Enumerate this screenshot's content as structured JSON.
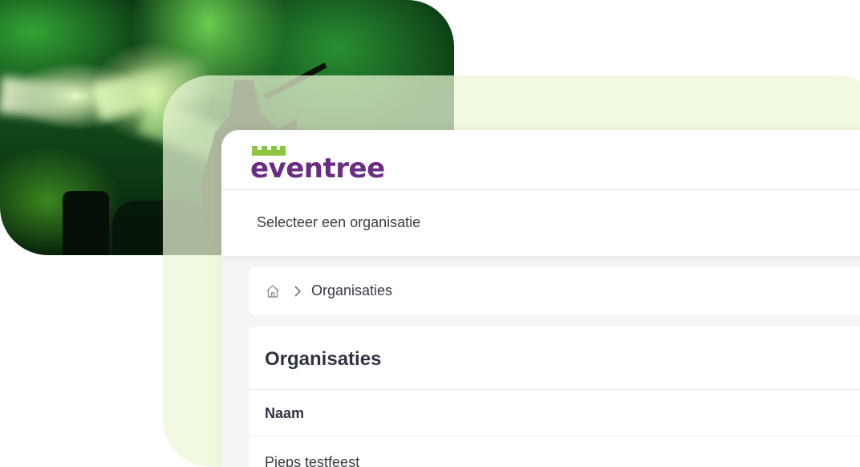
{
  "app": {
    "logo_text": "eventree",
    "org_selector_label": "Selecteer een organisatie"
  },
  "breadcrumb": {
    "home_icon": "home-icon",
    "separator_icon": "chevron-right-icon",
    "current": "Organisaties"
  },
  "panel": {
    "title": "Organisaties",
    "columns": [
      "Naam"
    ],
    "rows": [
      {
        "name": "Pieps testfeest"
      }
    ]
  },
  "colors": {
    "brand_purple": "#6b2d82",
    "brand_green": "#8cc63f",
    "backdrop_green": "#ecf6d6"
  }
}
